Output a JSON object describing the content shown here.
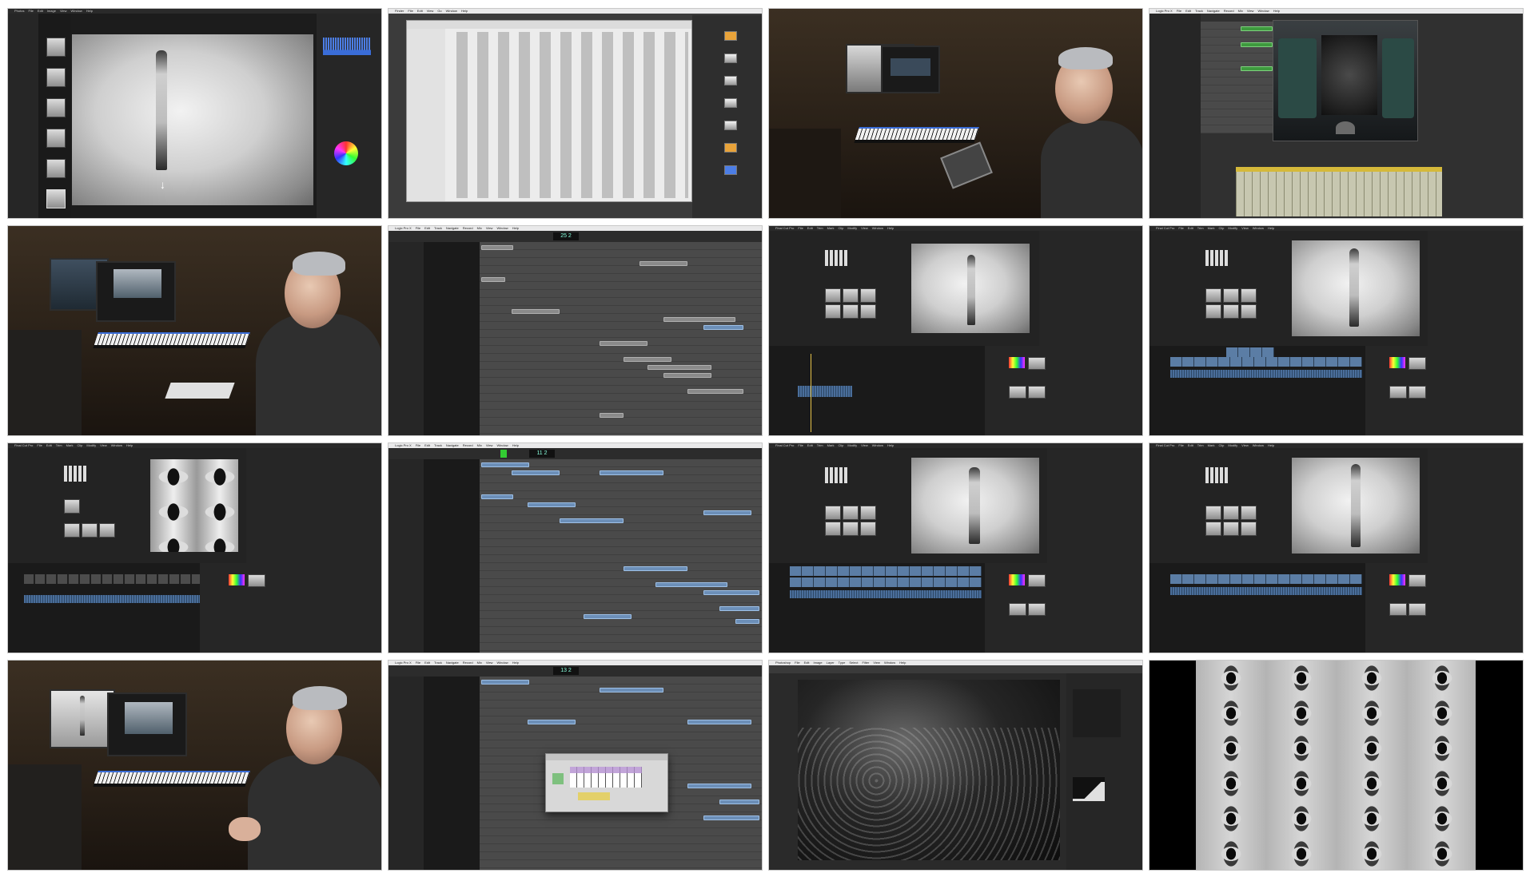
{
  "frames": [
    {
      "app": "Photos",
      "menu": [
        "File",
        "Edit",
        "Image",
        "View",
        "Window",
        "Help"
      ]
    },
    {
      "app": "Finder",
      "menu": [
        "File",
        "Edit",
        "View",
        "Go",
        "Window",
        "Help"
      ]
    },
    {
      "app": "studio-video"
    },
    {
      "app": "Logic Pro X",
      "menu": [
        "File",
        "Edit",
        "Track",
        "Navigate",
        "Record",
        "Mix",
        "View",
        "Window",
        "Help"
      ]
    },
    {
      "app": "studio-video"
    },
    {
      "app": "Logic Pro X",
      "menu": [
        "File",
        "Edit",
        "Track",
        "Navigate",
        "Record",
        "Mix",
        "View",
        "Window",
        "Help"
      ],
      "lcd": "25 2"
    },
    {
      "app": "Final Cut Pro",
      "menu": [
        "File",
        "Edit",
        "Trim",
        "Mark",
        "Clip",
        "Modify",
        "View",
        "Window",
        "Help"
      ]
    },
    {
      "app": "Final Cut Pro",
      "menu": [
        "File",
        "Edit",
        "Trim",
        "Mark",
        "Clip",
        "Modify",
        "View",
        "Window",
        "Help"
      ]
    },
    {
      "app": "Final Cut Pro",
      "menu": [
        "File",
        "Edit",
        "Trim",
        "Mark",
        "Clip",
        "Modify",
        "View",
        "Window",
        "Help"
      ]
    },
    {
      "app": "Logic Pro X",
      "menu": [
        "File",
        "Edit",
        "Track",
        "Navigate",
        "Record",
        "Mix",
        "View",
        "Window",
        "Help"
      ],
      "lcd": "11 2"
    },
    {
      "app": "Final Cut Pro",
      "menu": [
        "File",
        "Edit",
        "Trim",
        "Mark",
        "Clip",
        "Modify",
        "View",
        "Window",
        "Help"
      ]
    },
    {
      "app": "Final Cut Pro",
      "menu": [
        "File",
        "Edit",
        "Trim",
        "Mark",
        "Clip",
        "Modify",
        "View",
        "Window",
        "Help"
      ]
    },
    {
      "app": "studio-video"
    },
    {
      "app": "Logic Pro X",
      "menu": [
        "File",
        "Edit",
        "Track",
        "Navigate",
        "Record",
        "Mix",
        "View",
        "Window",
        "Help"
      ],
      "lcd": "13 2"
    },
    {
      "app": "Photoshop",
      "menu": [
        "File",
        "Edit",
        "Image",
        "Layer",
        "Type",
        "Select",
        "Filter",
        "View",
        "Window",
        "Help"
      ]
    },
    {
      "app": "kaleidoscope-frame"
    }
  ]
}
